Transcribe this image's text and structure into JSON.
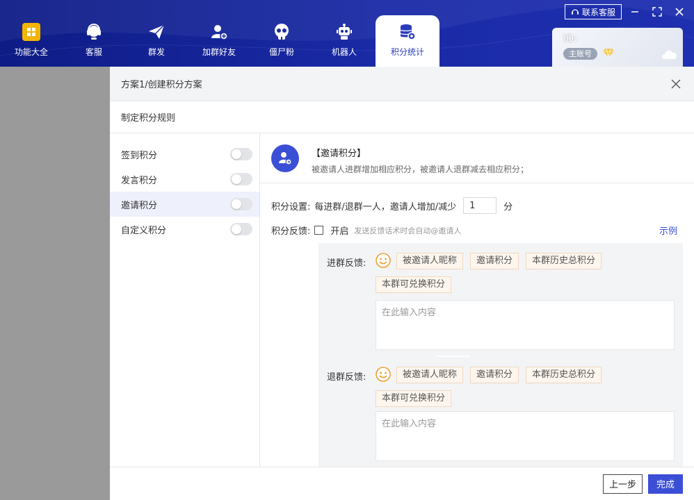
{
  "nav": {
    "items": [
      {
        "label": "功能大全",
        "icon": "grid-icon"
      },
      {
        "label": "客服",
        "icon": "headset-icon"
      },
      {
        "label": "群发",
        "icon": "paper-plane-icon"
      },
      {
        "label": "加群好友",
        "icon": "add-user-icon"
      },
      {
        "label": "僵尸粉",
        "icon": "skull-icon"
      },
      {
        "label": "机器人",
        "icon": "robot-icon"
      },
      {
        "label": "积分统计",
        "icon": "database-icon"
      }
    ],
    "active_index": 6,
    "accent_color": "#f4b400"
  },
  "top_actions": {
    "contact_label": "联系客服"
  },
  "account": {
    "id_label": "ID:",
    "badge": "主账号"
  },
  "dialog": {
    "title": "方案1/创建积分方案",
    "subtitle": "制定积分规则",
    "rules": [
      {
        "label": "签到积分",
        "enabled": false
      },
      {
        "label": "发言积分",
        "enabled": false
      },
      {
        "label": "邀请积分",
        "enabled": false
      },
      {
        "label": "自定义积分",
        "enabled": false
      }
    ],
    "active_rule_index": 2,
    "info": {
      "title": "【邀请积分】",
      "desc": "被邀请人进群增加相应积分，被邀请人退群减去相应积分；"
    },
    "setting": {
      "label": "积分设置:",
      "text": "每进群/退群一人，邀请人增加/减少",
      "value": "1",
      "unit": "分"
    },
    "feedback": {
      "label": "积分反馈:",
      "checkbox_label": "开启",
      "checked": false,
      "hint": "发送反馈话术时会自动@邀请人",
      "example_link": "示例"
    },
    "join_feedback": {
      "label": "进群反馈:",
      "tags": [
        "被邀请人昵称",
        "邀请积分",
        "本群历史总积分",
        "本群可兑换积分"
      ],
      "placeholder": "在此输入内容"
    },
    "leave_feedback": {
      "label": "退群反馈:",
      "tags": [
        "被邀请人昵称",
        "邀请积分",
        "本群历史总积分",
        "本群可兑换积分"
      ],
      "placeholder": "在此输入内容"
    },
    "footer": {
      "prev_label": "上一步",
      "done_label": "完成"
    },
    "colors": {
      "primary": "#3a4fd6",
      "tag_bg": "#fdf6ee",
      "tag_border": "#f0d8bd"
    }
  }
}
